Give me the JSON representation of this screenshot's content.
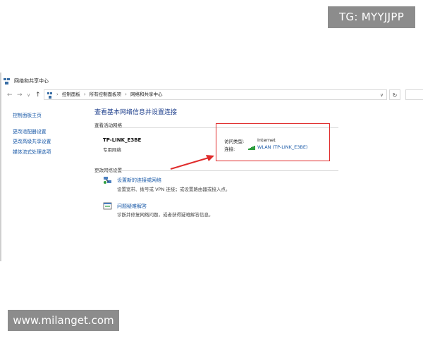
{
  "watermarks": {
    "tg": "TG: MYYJJPP",
    "url": "www.milanget.com"
  },
  "window": {
    "title": "网络和共享中心"
  },
  "nav": {
    "back": "←",
    "forward": "→",
    "dropdown": "∨",
    "up": "↑",
    "breadcrumbs": [
      "控制面板",
      "所有控制面板项",
      "网络和共享中心"
    ],
    "breadcrumb_sep": "›",
    "address_dropdown": "∨",
    "refresh": "↻"
  },
  "sidebar": {
    "items": [
      "控制面板主页",
      "更改适配器设置",
      "更改高级共享设置",
      "媒体流式处理选项"
    ]
  },
  "main": {
    "title": "查看基本网络信息并设置连接",
    "active_networks_heading": "查看活动网络",
    "network_name": "TP-LINK_E3BE",
    "network_category": "专用网络",
    "access_type_label": "访问类型:",
    "access_type_value": "Internet",
    "connection_label": "连接:",
    "connection_value": "WLAN (TP-LINK_E3BE)",
    "change_settings_heading": "更改网络设置",
    "tasks": [
      {
        "icon": "new-connection-icon",
        "link": "设置新的连接或网络",
        "desc": "设置宽带、拨号或 VPN 连接；或设置路由器或接入点。"
      },
      {
        "icon": "troubleshoot-icon",
        "link": "问题疑难解答",
        "desc": "诊断并修复网络问题，或者获得疑难解答信息。"
      }
    ]
  },
  "colors": {
    "link": "#1a5aa8",
    "title": "#1e3f8c",
    "highlight_box": "#e02b2b",
    "arrow": "#e02b2b",
    "watermark_bg": "#8c8c8c",
    "signal": "#2e9e3e"
  }
}
